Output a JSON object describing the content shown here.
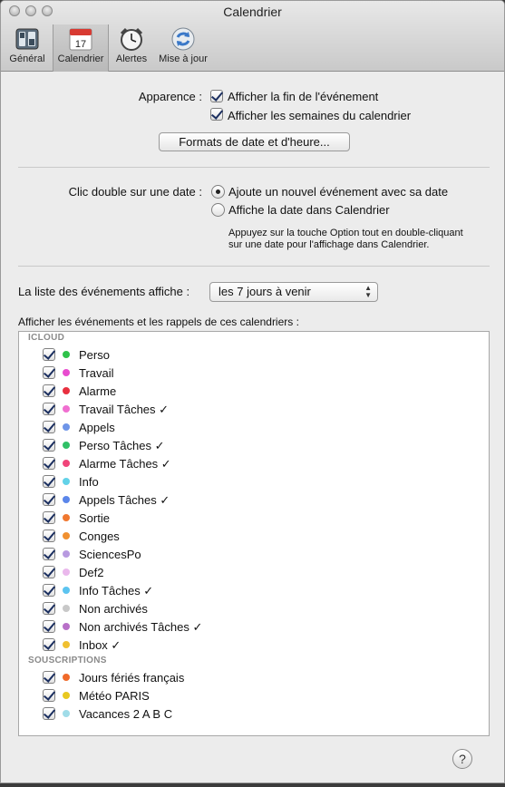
{
  "window": {
    "title": "Calendrier"
  },
  "toolbar": {
    "items": [
      {
        "label": "Général"
      },
      {
        "label": "Calendrier",
        "icon_text": "17"
      },
      {
        "label": "Alertes"
      },
      {
        "label": "Mise à jour"
      }
    ]
  },
  "appearance": {
    "label": "Apparence :",
    "option1": "Afficher la fin de l'événement",
    "option1_checked": true,
    "option2": "Afficher les semaines du calendrier",
    "option2_checked": true,
    "formats_button": "Formats de date et d'heure..."
  },
  "double_click": {
    "label": "Clic double sur une date :",
    "option1": "Ajoute un nouvel événement avec sa date",
    "option2": "Affiche la date dans Calendrier",
    "selected": 1,
    "hint_line1": "Appuyez sur la touche Option tout en double-cliquant",
    "hint_line2": "sur une date pour l'affichage dans Calendrier."
  },
  "event_list": {
    "label": "La liste des événements affiche :",
    "selected": "les 7 jours à venir"
  },
  "calendars": {
    "heading": "Afficher les événements et les rappels de ces calendriers :",
    "groups": [
      {
        "name": "ICLOUD",
        "items": [
          {
            "label": "Perso",
            "color": "#2fc24a",
            "checked": true
          },
          {
            "label": "Travail",
            "color": "#e84ccf",
            "checked": true
          },
          {
            "label": "Alarme",
            "color": "#e8303f",
            "checked": true
          },
          {
            "label": "Travail Tâches ✓",
            "color": "#f06fd0",
            "checked": true
          },
          {
            "label": "Appels",
            "color": "#6e95e8",
            "checked": true
          },
          {
            "label": "Perso Tâches ✓",
            "color": "#30c067",
            "checked": true
          },
          {
            "label": "Alarme Tâches ✓",
            "color": "#f0457a",
            "checked": true
          },
          {
            "label": "Info",
            "color": "#62d2e8",
            "checked": true
          },
          {
            "label": "Appels Tâches ✓",
            "color": "#5b86ea",
            "checked": true
          },
          {
            "label": "Sortie",
            "color": "#f07830",
            "checked": true
          },
          {
            "label": "Conges",
            "color": "#f09030",
            "checked": true
          },
          {
            "label": "SciencesPo",
            "color": "#b89ae0",
            "checked": true
          },
          {
            "label": "Def2",
            "color": "#eab8ec",
            "checked": true
          },
          {
            "label": "Info Tâches ✓",
            "color": "#5cc4f0",
            "checked": true
          },
          {
            "label": "Non archivés",
            "color": "#c8c8c8",
            "checked": true
          },
          {
            "label": "Non archivés Tâches ✓",
            "color": "#b870c8",
            "checked": true
          },
          {
            "label": "Inbox ✓",
            "color": "#f0c030",
            "checked": true
          }
        ]
      },
      {
        "name": "SOUSCRIPTIONS",
        "items": [
          {
            "label": "Jours fériés français",
            "color": "#f06a2a",
            "checked": true
          },
          {
            "label": "Météo PARIS",
            "color": "#e8c820",
            "checked": true
          },
          {
            "label": "Vacances 2 A B C",
            "color": "#a0dce8",
            "checked": true
          }
        ]
      }
    ]
  },
  "help_button": "?"
}
